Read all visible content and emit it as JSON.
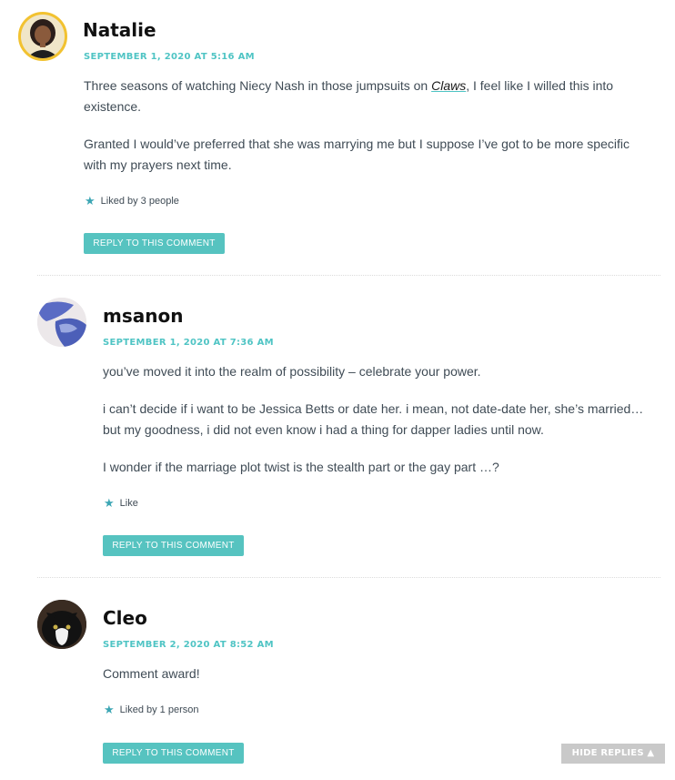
{
  "comments": [
    {
      "author": "Natalie",
      "date": "SEPTEMBER 1, 2020 AT 5:16 AM",
      "p1_before": "Three seasons of watching Niecy Nash in those jumpsuits on ",
      "p1_link": "Claws",
      "p1_after": ", I feel like I willed this into existence.",
      "p2": "Granted I would’ve preferred that she was marrying me but I suppose I’ve got to be more specific with my prayers next time.",
      "likes": "Liked by 3 people",
      "reply": "REPLY TO THIS COMMENT"
    },
    {
      "author": "msanon",
      "date": "SEPTEMBER 1, 2020 AT 7:36 AM",
      "p1": "you’ve moved it into the realm of possibility – celebrate your power.",
      "p2": "i can’t decide if i want to be Jessica Betts or date her. i mean, not date-date her, she’s married… but my goodness, i did not even know i had a thing for dapper ladies until now.",
      "p3": "I wonder if the marriage plot twist is the stealth part or the gay part …?",
      "likes": "Like",
      "reply": "REPLY TO THIS COMMENT"
    },
    {
      "author": "Cleo",
      "date": "SEPTEMBER 2, 2020 AT 8:52 AM",
      "p1": "Comment award!",
      "likes": "Liked by 1 person",
      "reply": "REPLY TO THIS COMMENT"
    }
  ],
  "hide_replies": "HIDE REPLIES ▲",
  "icons": {
    "like": "star-icon"
  },
  "colors": {
    "accent": "#56c3c0",
    "date": "#4fc4c4",
    "star": "#3ca6b4",
    "hide_button": "#c9c9c9"
  }
}
